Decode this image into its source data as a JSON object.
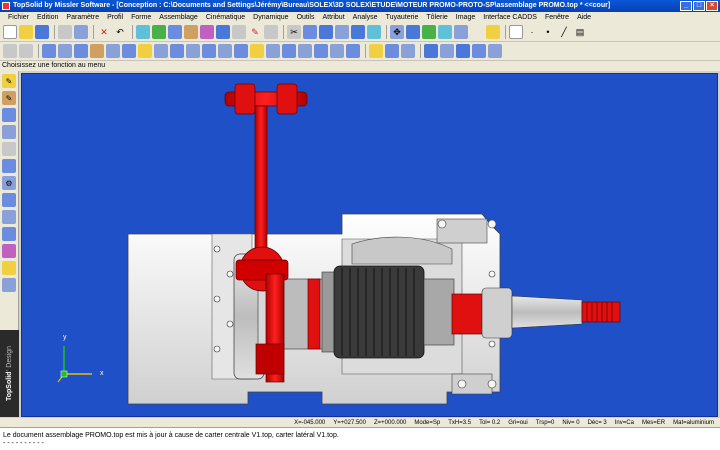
{
  "window": {
    "title": "TopSolid by Missler Software - [Conception : C:\\Documents and Settings\\Jérémy\\Bureau\\SOLEX\\3D SOLEX\\ETUDE\\MOTEUR PROMO-PROTO-SP\\assemblage PROMO.top *  <<cour]"
  },
  "menu": {
    "items": [
      {
        "label": "Fichier"
      },
      {
        "label": "Edition"
      },
      {
        "label": "Paramètre"
      },
      {
        "label": "Profil"
      },
      {
        "label": "Forme"
      },
      {
        "label": "Assemblage"
      },
      {
        "label": "Cinématique"
      },
      {
        "label": "Dynamique"
      },
      {
        "label": "Outils"
      },
      {
        "label": "Attribut"
      },
      {
        "label": "Analyse"
      },
      {
        "label": "Tuyauterie"
      },
      {
        "label": "Tôlerie"
      },
      {
        "label": "Image"
      },
      {
        "label": "Interface CADDS"
      },
      {
        "label": "Fenêtre"
      },
      {
        "label": "Aide"
      }
    ]
  },
  "prompt": {
    "text": "Choisissez une fonction au menu"
  },
  "brand": {
    "name": "TopSolid",
    "suffix": "' Design"
  },
  "status": {
    "x": "X=-045.000",
    "y": "Y=+027.500",
    "z": "Z=+000.000",
    "mode": "Mode=Sp",
    "txh": "TxH=3.5",
    "tol": "Tol=   0.2",
    "gri": "Gri=oui",
    "trsp": "Trsp=0",
    "niv": "Niv=  0",
    "dec": "Déc= 3",
    "inv": "Inv=Ca",
    "mes": "Mes=ER",
    "mat": "Mat=aluminium"
  },
  "message": {
    "line1": "Le document assemblage PROMO.top est mis à jour à cause de carter centrale V1.top, carter latéral V1.top.",
    "line2": "- - - - - - - - - -"
  },
  "axes": {
    "x": "x",
    "y": "y"
  },
  "colors": {
    "viewport_bg": "#2050c8",
    "part_red": "#e01010",
    "part_white": "#f4f4f4"
  }
}
